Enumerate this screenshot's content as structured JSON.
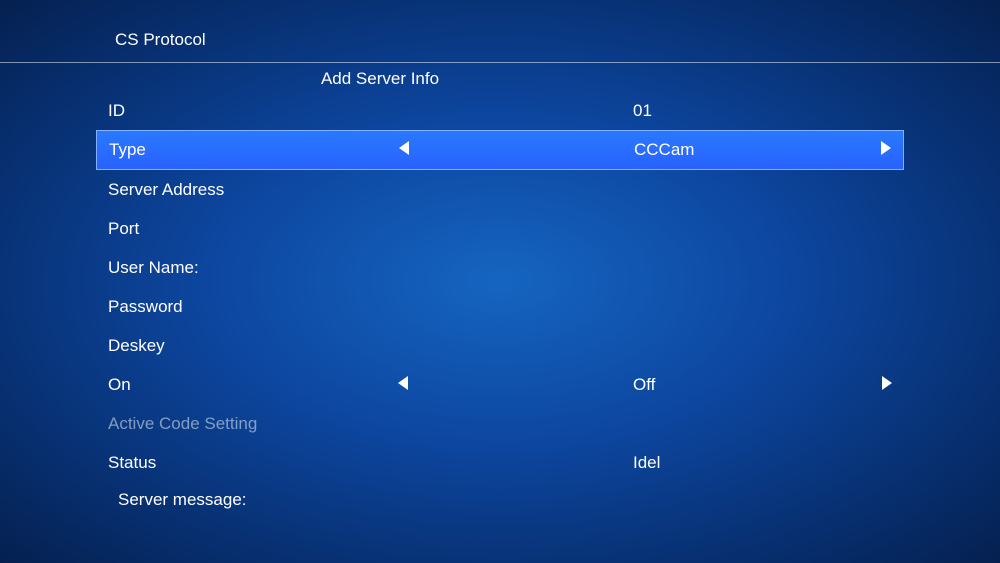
{
  "header": {
    "title": "CS Protocol"
  },
  "subtitle": "Add Server Info",
  "rows": {
    "id": {
      "label": "ID",
      "value": "01"
    },
    "type": {
      "label": "Type",
      "value": "CCCam"
    },
    "serverAddress": {
      "label": "Server Address",
      "value": ""
    },
    "port": {
      "label": "Port",
      "value": ""
    },
    "userName": {
      "label": "User Name:",
      "value": ""
    },
    "password": {
      "label": "Password",
      "value": ""
    },
    "deskey": {
      "label": "Deskey",
      "value": ""
    },
    "on": {
      "label": "On",
      "value": "Off"
    },
    "activeCode": {
      "label": "Active Code Setting",
      "value": ""
    },
    "status": {
      "label": "Status",
      "value": "Idel"
    },
    "serverMessage": {
      "label": "Server message:",
      "value": ""
    }
  }
}
